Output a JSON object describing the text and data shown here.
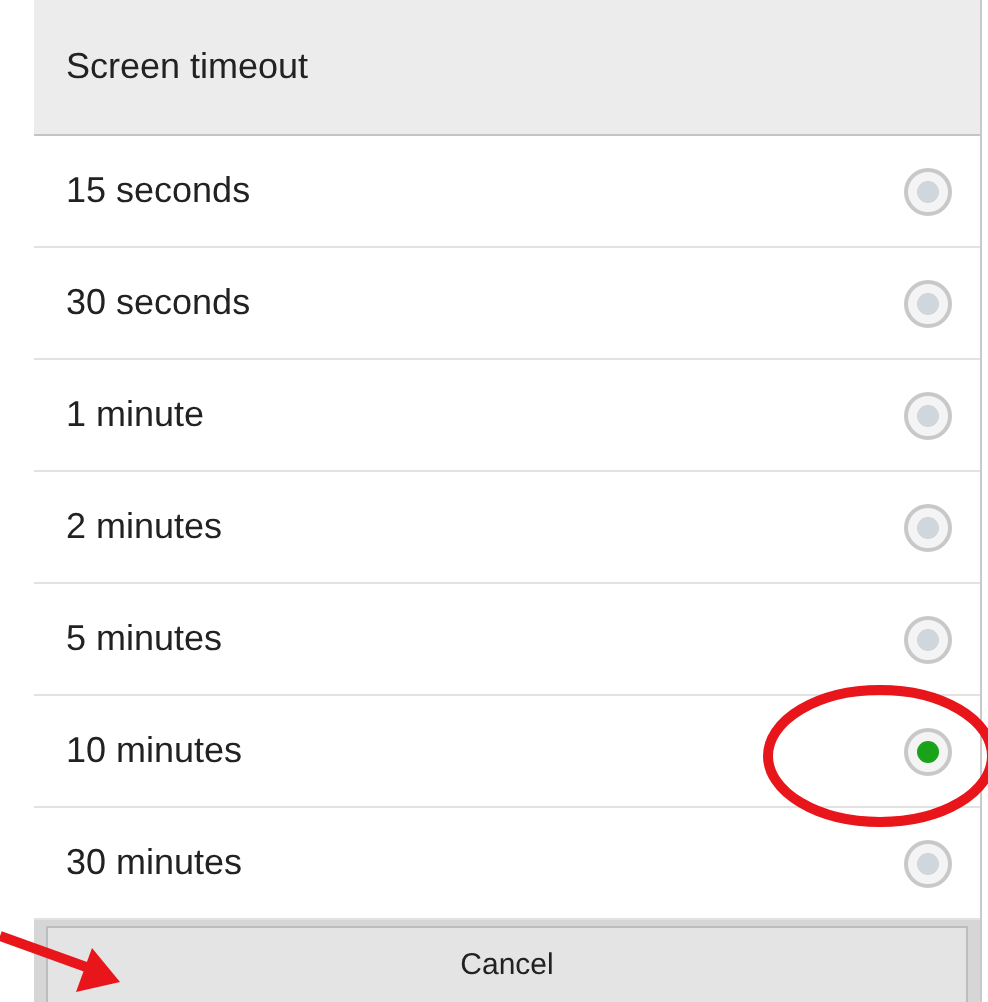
{
  "dialog": {
    "title": "Screen timeout",
    "options": [
      {
        "label": "15 seconds",
        "selected": false
      },
      {
        "label": "30 seconds",
        "selected": false
      },
      {
        "label": "1 minute",
        "selected": false
      },
      {
        "label": "2 minutes",
        "selected": false
      },
      {
        "label": "5 minutes",
        "selected": false
      },
      {
        "label": "10 minutes",
        "selected": true
      },
      {
        "label": "30 minutes",
        "selected": false
      }
    ],
    "cancel_button": "Cancel"
  },
  "annotations": [
    {
      "kind": "ellipse"
    },
    {
      "kind": "arrow"
    }
  ]
}
